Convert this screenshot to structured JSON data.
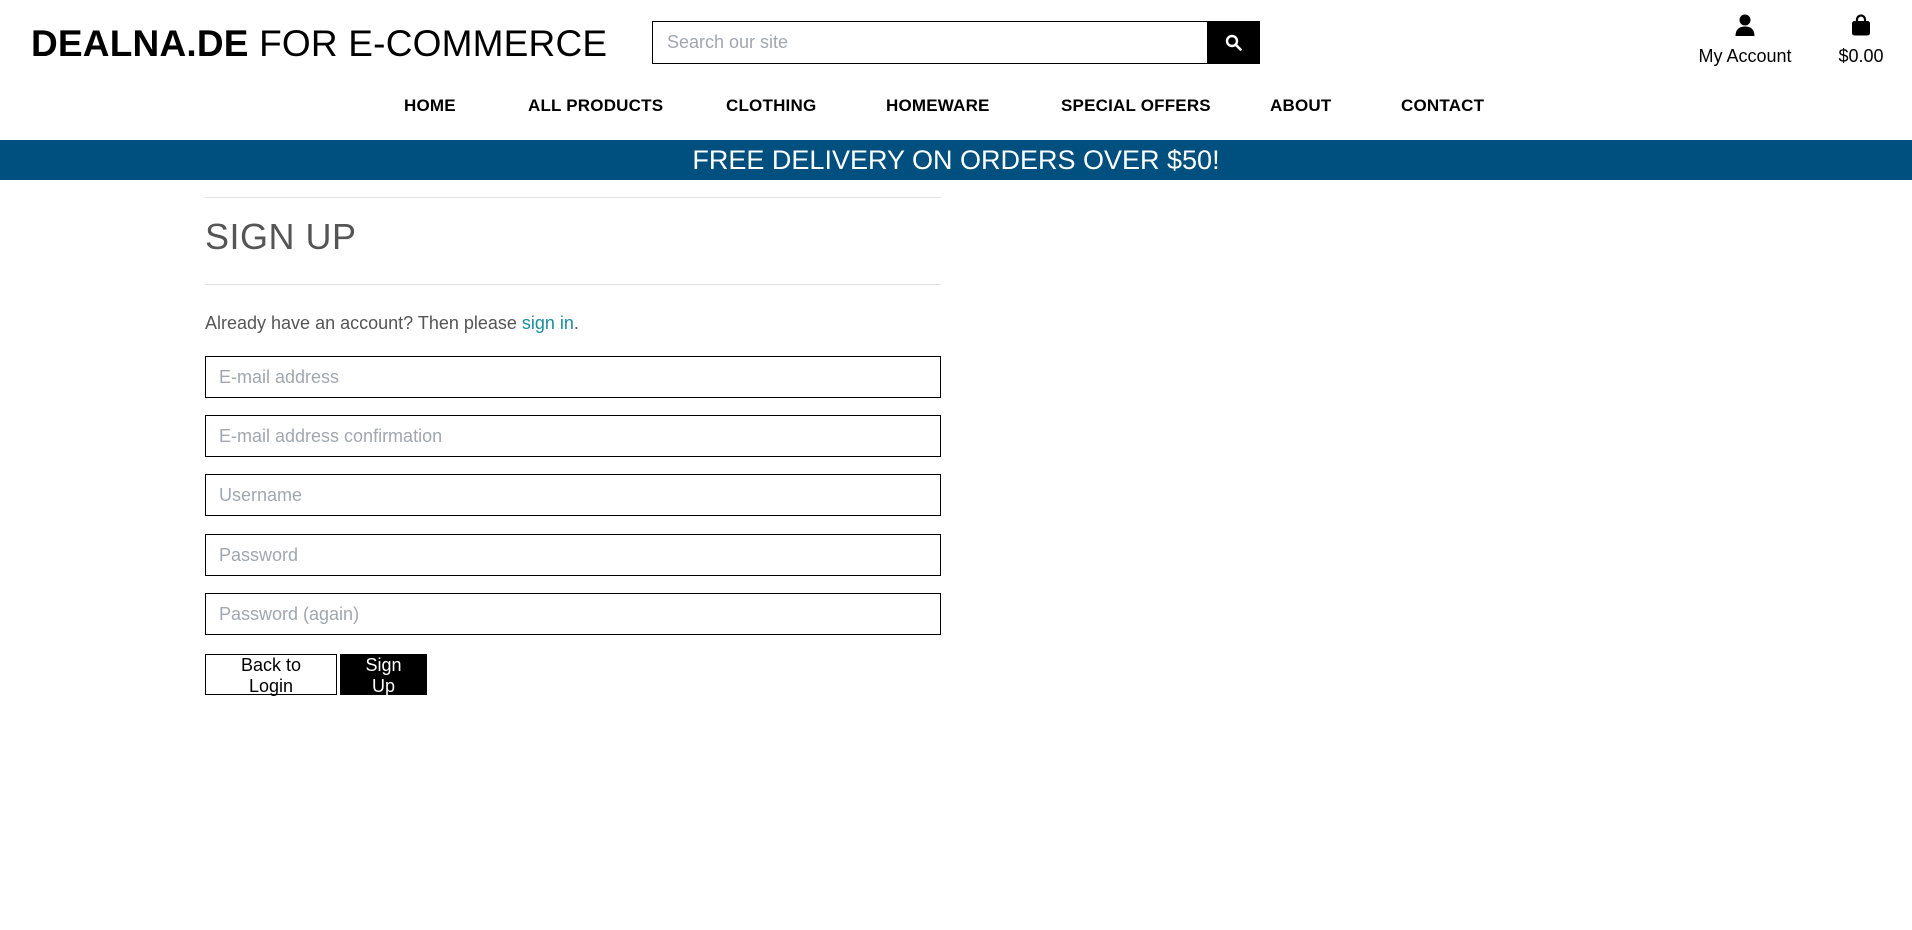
{
  "header": {
    "logo_bold": "DEALNA.DE",
    "logo_rest": " FOR E-COMMERCE",
    "search_placeholder": "Search our site",
    "account_label": "My Account",
    "cart_total": "$0.00"
  },
  "nav": {
    "items": [
      "HOME",
      "ALL PRODUCTS",
      "CLOTHING",
      "HOMEWARE",
      "SPECIAL OFFERS",
      "ABOUT",
      "CONTACT"
    ]
  },
  "banner": {
    "text": "FREE DELIVERY ON ORDERS OVER $50!",
    "color": "#00507f"
  },
  "signup": {
    "title": "SIGN UP",
    "intro_prefix": "Already have an account? Then please ",
    "intro_link": "sign in",
    "intro_suffix": ".",
    "fields": {
      "email": "E-mail address",
      "email_confirm": "E-mail address confirmation",
      "username": "Username",
      "password": "Password",
      "password_again": "Password (again)"
    },
    "back_button": "Back to Login",
    "submit_button": "Sign Up"
  },
  "colors": {
    "link": "#1b8fa0",
    "heading": "#555555"
  }
}
